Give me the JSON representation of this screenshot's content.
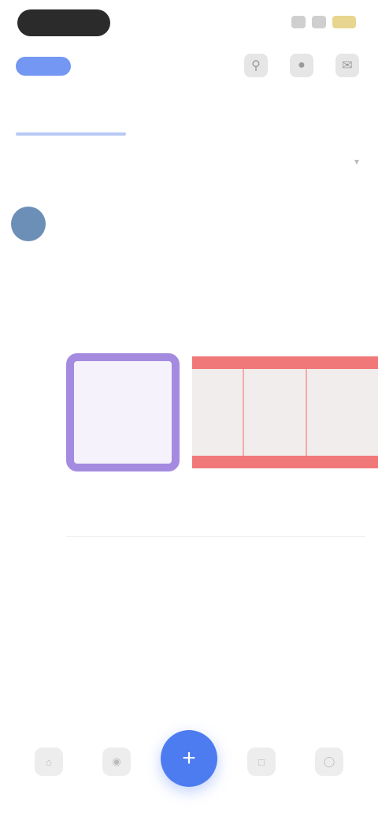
{
  "status_bar": {
    "time": ""
  },
  "top_bar": {
    "brand": "",
    "actions": [
      {
        "icon": "search-icon"
      },
      {
        "icon": "bell-icon"
      },
      {
        "icon": "mail-icon"
      }
    ]
  },
  "tabs": [
    {
      "label": "",
      "active": true
    },
    {
      "label": "",
      "active": false
    },
    {
      "label": "",
      "active": false
    }
  ],
  "filter": {
    "left_label": "",
    "right_label": ""
  },
  "post": {
    "author": "",
    "meta": "",
    "body": "",
    "media_card_caption": "",
    "timestamp": ""
  },
  "bottom_nav": {
    "items": [
      {
        "icon": "home-icon"
      },
      {
        "icon": "compass-icon"
      },
      {
        "icon": "plus-icon"
      },
      {
        "icon": "chat-icon"
      },
      {
        "icon": "profile-icon"
      }
    ]
  },
  "colors": {
    "accent": "#4d7cf0",
    "card_border": "#a58be0",
    "strip_border": "#f17878",
    "avatar": "#6c8fb8"
  }
}
